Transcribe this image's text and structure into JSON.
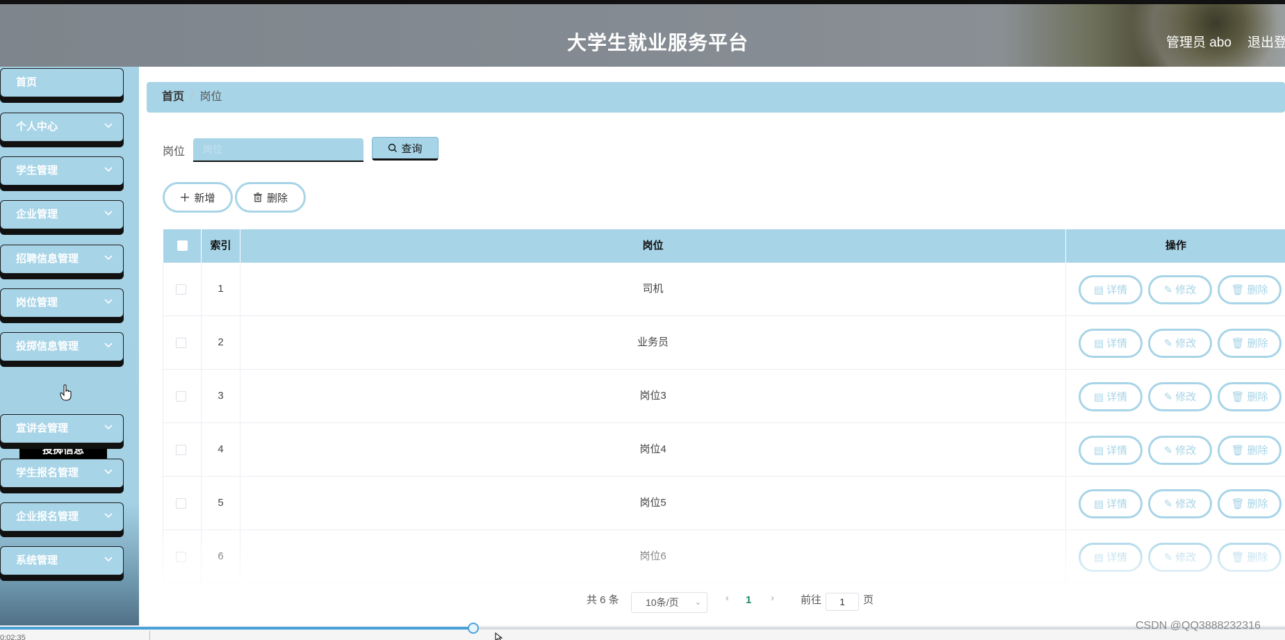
{
  "header": {
    "title": "大学生就业服务平台",
    "admin_label": "管理员 abo",
    "logout_label": "退出登录"
  },
  "sidebar": {
    "items": [
      {
        "label": "首页",
        "has_chevron": false
      },
      {
        "label": "个人中心",
        "has_chevron": true
      },
      {
        "label": "学生管理",
        "has_chevron": true
      },
      {
        "label": "企业管理",
        "has_chevron": true
      },
      {
        "label": "招聘信息管理",
        "has_chevron": true
      },
      {
        "label": "岗位管理",
        "has_chevron": true
      },
      {
        "label": "投掷信息管理",
        "has_chevron": true
      },
      {
        "label": "宣讲会管理",
        "has_chevron": true
      },
      {
        "label": "学生报名管理",
        "has_chevron": true
      },
      {
        "label": "企业报名管理",
        "has_chevron": true
      },
      {
        "label": "系统管理",
        "has_chevron": true
      }
    ],
    "popup_label": "投掷信息"
  },
  "breadcrumb": {
    "home": "首页",
    "separator": "/",
    "current": "岗位"
  },
  "search": {
    "label": "岗位",
    "placeholder": "岗位",
    "query_button": "查询"
  },
  "actions": {
    "add_label": "新增",
    "delete_label": "删除"
  },
  "table": {
    "headers": {
      "index": "索引",
      "position": "岗位",
      "operation": "操作"
    },
    "rows": [
      {
        "index": "1",
        "position": "司机"
      },
      {
        "index": "2",
        "position": "业务员"
      },
      {
        "index": "3",
        "position": "岗位3"
      },
      {
        "index": "4",
        "position": "岗位4"
      },
      {
        "index": "5",
        "position": "岗位5"
      },
      {
        "index": "6",
        "position": "岗位6"
      }
    ],
    "row_actions": {
      "detail": "详情",
      "edit": "修改",
      "delete": "删除"
    }
  },
  "pagination": {
    "total_text": "共 6 条",
    "page_size": "10条/页",
    "current_page": "1",
    "goto_label": "前往",
    "goto_value": "1",
    "page_suffix": "页"
  },
  "video": {
    "time_text": "0:02:35",
    "progress": 0.368
  },
  "watermark": "CSDN @QQ3888232316",
  "colors": {
    "accent": "#a7d4e7",
    "page_number": "#1d8b6a",
    "progress": "#4aa2d8"
  }
}
